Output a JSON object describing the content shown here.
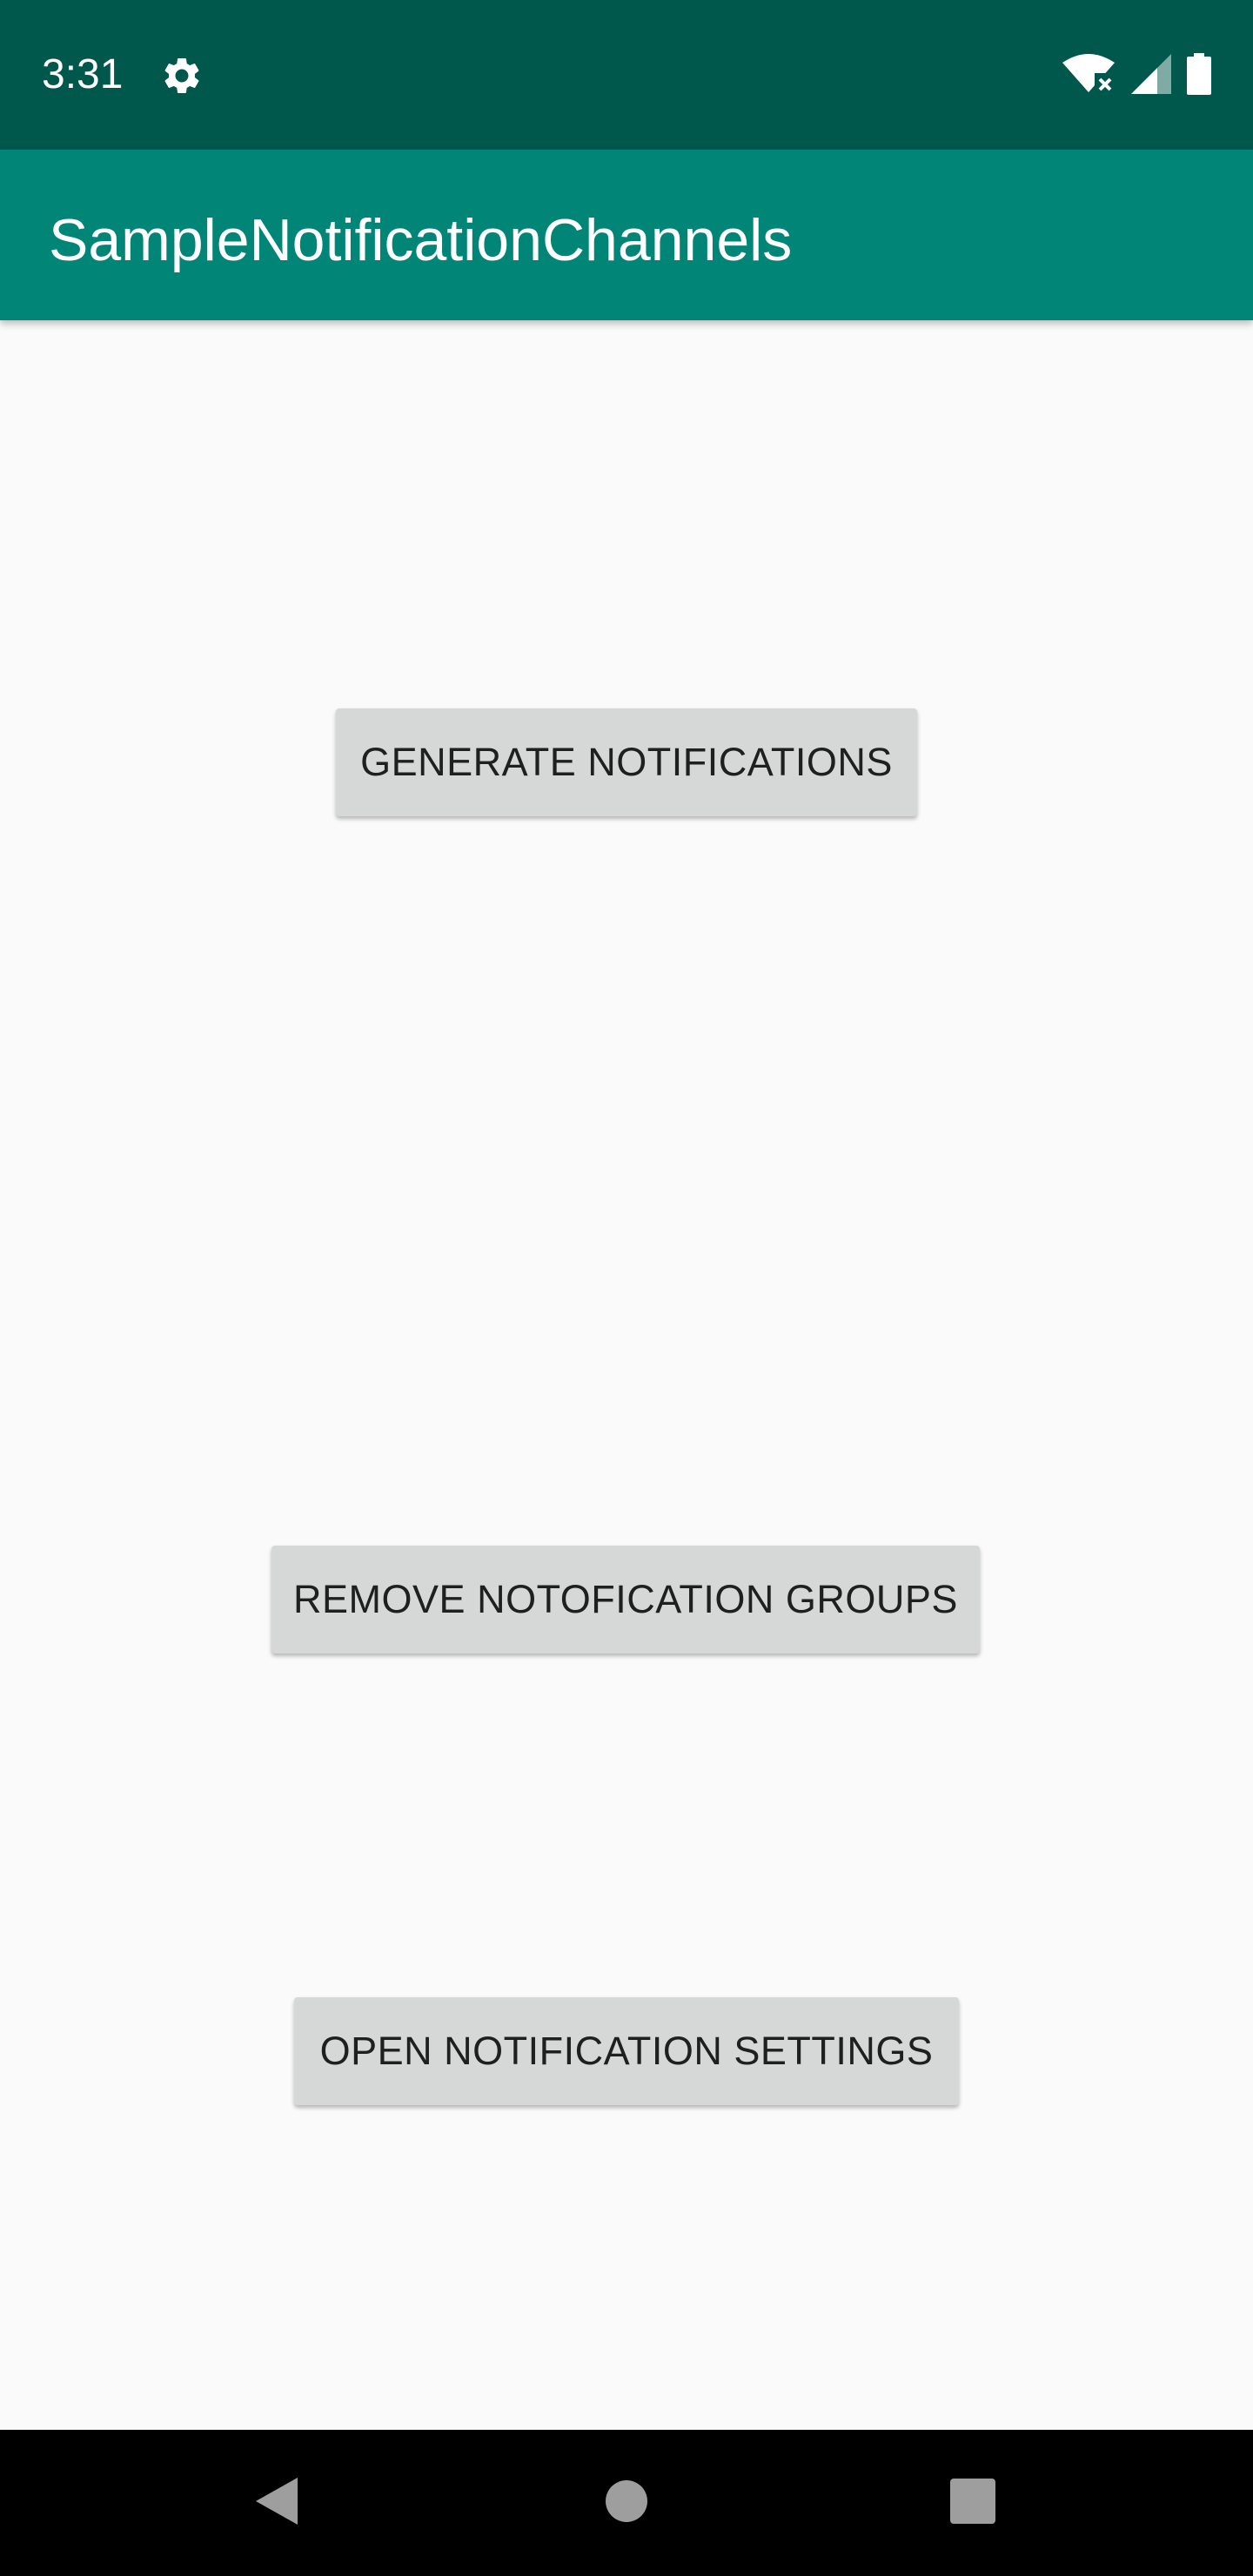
{
  "status_bar": {
    "time": "3:31",
    "icons": [
      "gear-icon",
      "wifi-icon",
      "signal-icon",
      "battery-icon"
    ],
    "color": "#00574b"
  },
  "app_bar": {
    "title": "SampleNotificationChannels",
    "color": "#008577"
  },
  "buttons": {
    "generate": "GENERATE NOTIFICATIONS",
    "remove": "REMOVE NOTOFICATION GROUPS",
    "open_settings": "OPEN NOTIFICATION SETTINGS",
    "background": "#d6d7d7"
  },
  "nav_bar": {
    "icons": [
      "back-icon",
      "home-icon",
      "recents-icon"
    ]
  }
}
